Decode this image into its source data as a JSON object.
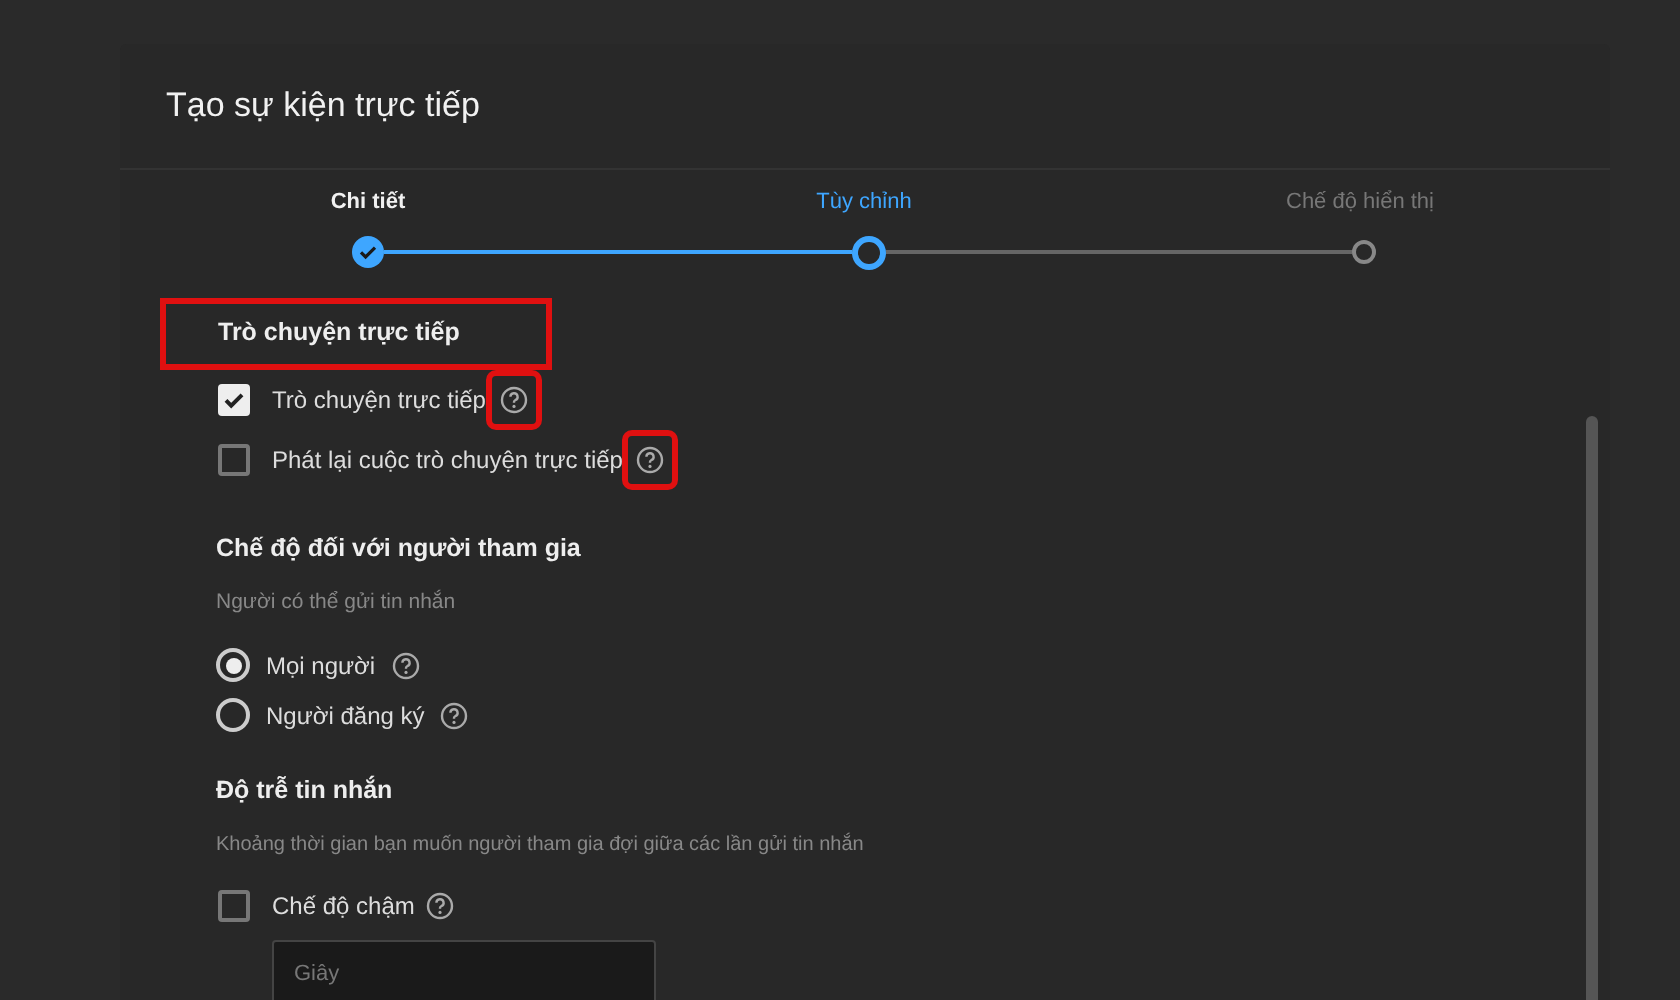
{
  "window": {
    "title": "Tạo sự kiện trực tiếp"
  },
  "steps": [
    {
      "label": "Chi tiết",
      "completed": true,
      "selected": false
    },
    {
      "label": "Tùy chỉnh",
      "completed": false,
      "selected": true
    },
    {
      "label": "Chế độ hiển thị",
      "completed": false,
      "selected": false
    }
  ],
  "live_chat": {
    "heading": "Trò chuyện trực tiếp",
    "highlighted": true,
    "options": [
      {
        "label": "Trò chuyện trực tiếp",
        "checked": true,
        "help_highlighted": true
      },
      {
        "label": "Phát lại cuộc trò chuyện trực tiếp",
        "checked": false,
        "help_highlighted": true
      }
    ]
  },
  "participant_mode": {
    "heading": "Chế độ đối với người tham gia",
    "description": "Người có thể gửi tin nhắn",
    "options": [
      {
        "label": "Mọi người",
        "selected": true
      },
      {
        "label": "Người đăng ký",
        "selected": false
      }
    ]
  },
  "message_delay": {
    "heading": "Độ trễ tin nhắn",
    "description": "Khoảng thời gian bạn muốn người tham gia đợi giữa các lần gửi tin nhắn",
    "slow_mode": {
      "label": "Chế độ chậm",
      "checked": false
    },
    "seconds_field": {
      "placeholder": "Giây"
    }
  }
}
